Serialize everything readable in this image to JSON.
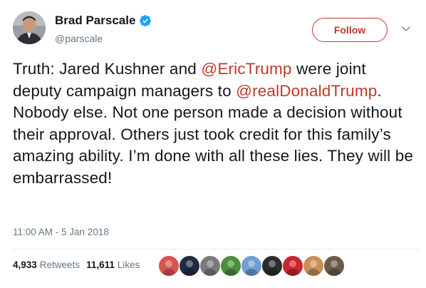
{
  "author": {
    "display_name": "Brad Parscale",
    "handle": "@parscale",
    "verified": true,
    "avatar_icon": "profile-photo"
  },
  "follow_button": {
    "label": "Follow",
    "color": "#c0392b"
  },
  "menu_icon": "chevron-down-icon",
  "tweet": {
    "segments": [
      {
        "text": "Truth: Jared Kushner and ",
        "type": "text"
      },
      {
        "text": "@EricTrump",
        "type": "mention"
      },
      {
        "text": " were joint deputy campaign managers to ",
        "type": "text"
      },
      {
        "text": "@realDonaldTrump",
        "type": "mention"
      },
      {
        "text": ". Nobody else. Not one person made a decision without their approval. Others just took credit for this family’s amazing ability. I’m done with all these lies. They will be embarrassed!",
        "type": "text"
      }
    ],
    "timestamp": "11:00 AM - 5 Jan 2018"
  },
  "stats": {
    "retweets_count": "4,933",
    "retweets_label": "Retweets",
    "likes_count": "11,611",
    "likes_label": "Likes"
  },
  "likers": [
    {
      "icon": "liker-avatar-flag",
      "color": "#d9534f"
    },
    {
      "icon": "liker-avatar-badge",
      "color": "#1f2a44"
    },
    {
      "icon": "liker-avatar-text",
      "color": "#7a7a7a"
    },
    {
      "icon": "liker-avatar-leaves",
      "color": "#4a8f3a"
    },
    {
      "icon": "liker-avatar-sky",
      "color": "#6f9fd1"
    },
    {
      "icon": "liker-avatar-cat",
      "color": "#2b2b2b"
    },
    {
      "icon": "liker-avatar-red",
      "color": "#c8272d"
    },
    {
      "icon": "liker-avatar-person",
      "color": "#c98f5a"
    },
    {
      "icon": "liker-avatar-dog",
      "color": "#6b5a4a"
    }
  ],
  "colors": {
    "mention": "#c0392b",
    "verified": "#1da1f2",
    "muted": "#657786"
  }
}
